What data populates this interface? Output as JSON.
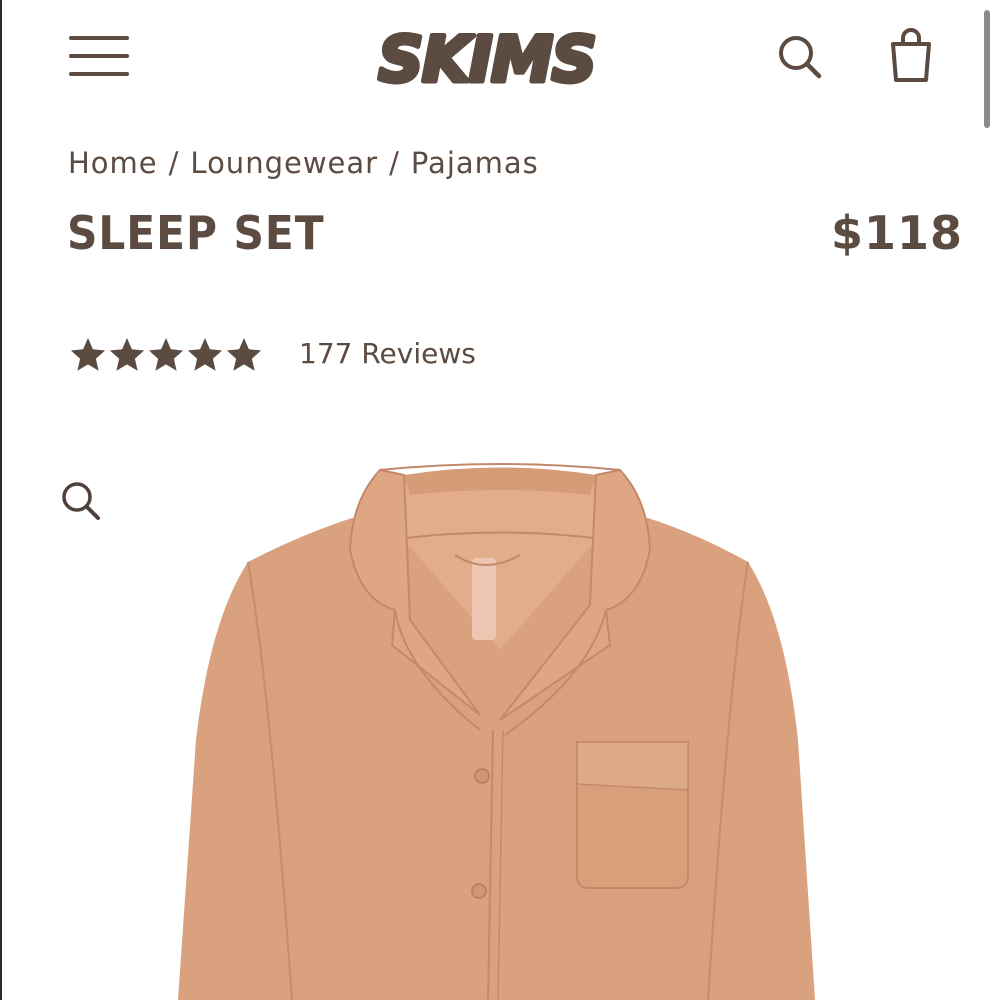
{
  "header": {
    "menu_icon": "hamburger-menu-icon",
    "logo_text": "SKIMS",
    "search_icon": "search-icon",
    "bag_icon": "shopping-bag-icon"
  },
  "breadcrumb": {
    "items": [
      "Home",
      "Loungewear",
      "Pajamas"
    ],
    "separator": "/"
  },
  "product": {
    "title": "SLEEP SET",
    "price": "$118",
    "rating": 5,
    "rating_max": 5,
    "reviews_label": "177 Reviews",
    "image_zoom_icon": "magnifier-zoom-icon",
    "image_subject": "long-sleeve button-up pajama shirt with notch collar and chest pocket"
  },
  "colors": {
    "brand_text": "#5b4b41",
    "background": "#ffffff",
    "garment": "#d9a17e"
  }
}
